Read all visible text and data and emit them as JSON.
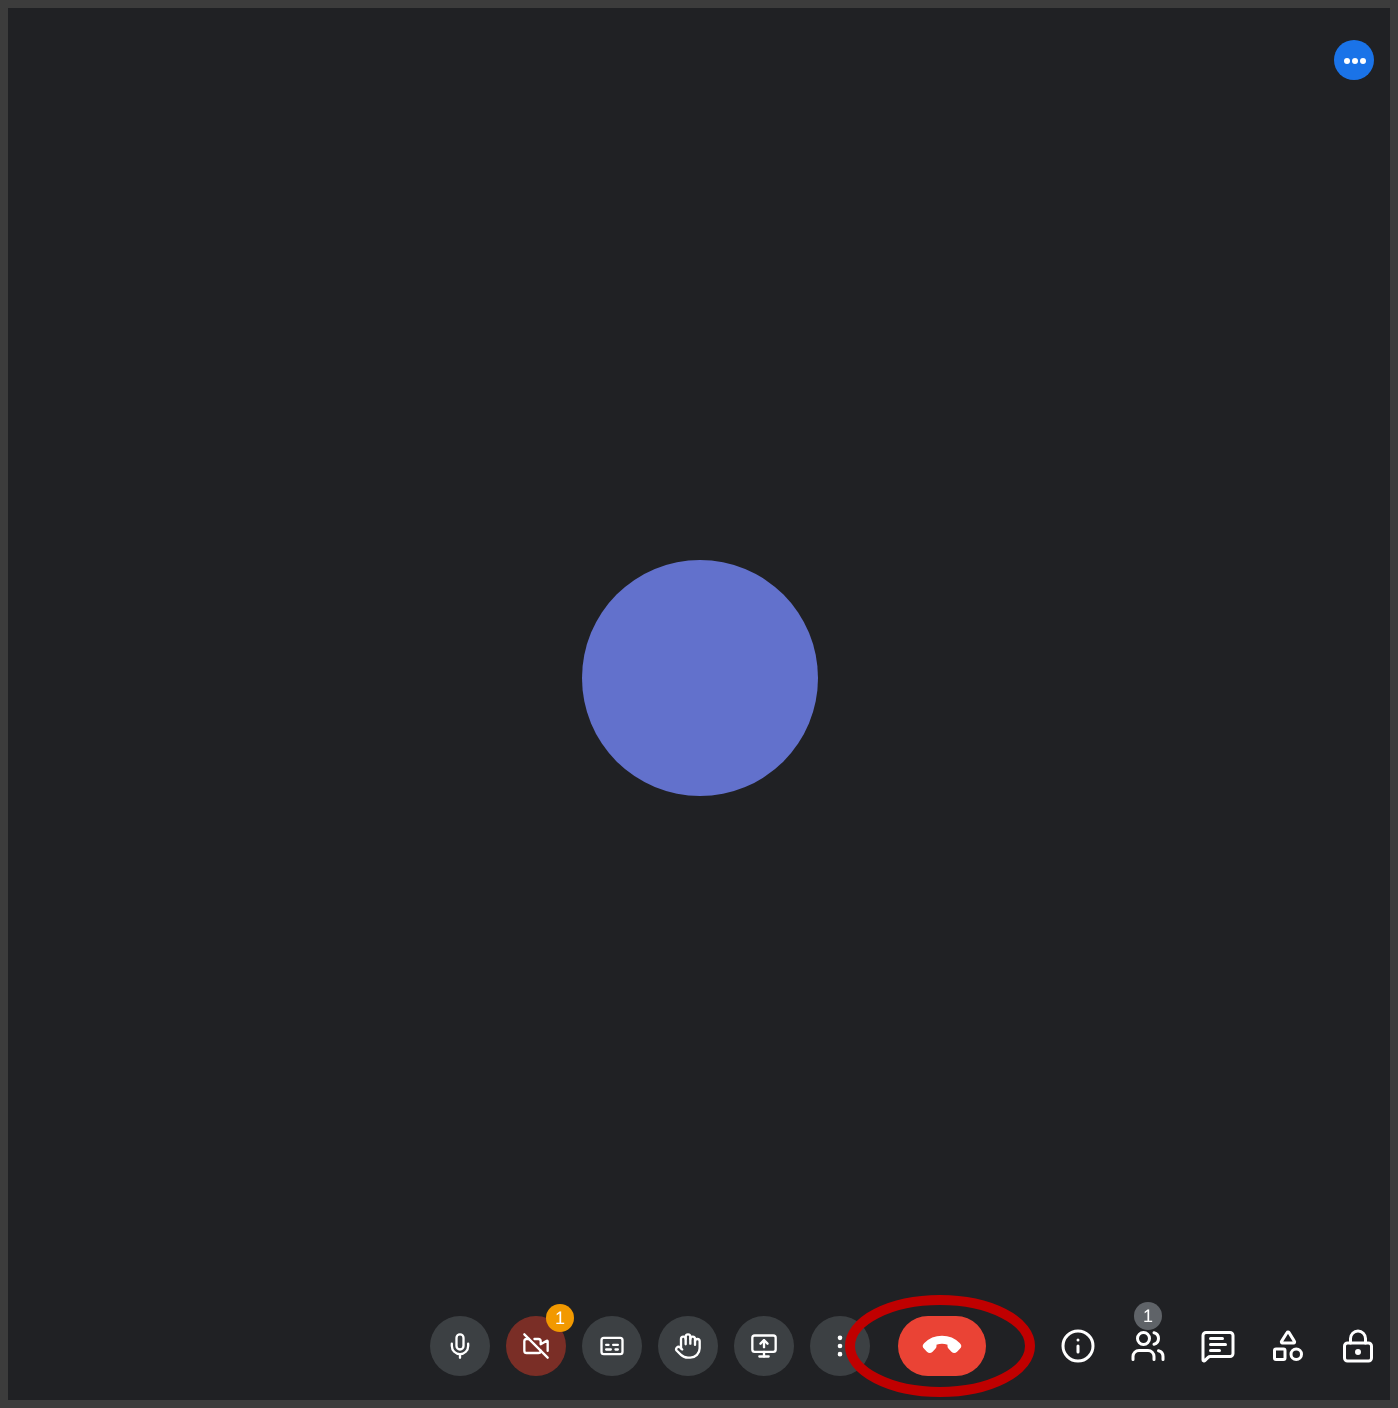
{
  "controls": [
    {
      "kind": "mic",
      "on": true
    },
    {
      "kind": "camera",
      "on": false,
      "badge": "1"
    },
    {
      "kind": "captions",
      "on": true
    },
    {
      "kind": "hand",
      "on": true
    },
    {
      "kind": "present",
      "on": true
    },
    {
      "kind": "more",
      "on": true
    },
    {
      "kind": "hangup",
      "on": true
    }
  ],
  "side_controls": [
    {
      "kind": "info"
    },
    {
      "kind": "people",
      "badge": "1"
    },
    {
      "kind": "chat"
    },
    {
      "kind": "activities"
    },
    {
      "kind": "lock"
    }
  ]
}
